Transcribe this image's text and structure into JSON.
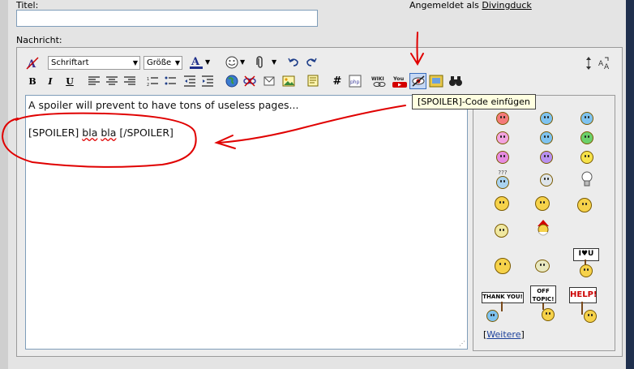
{
  "form": {
    "title_label": "Titel:",
    "logged_in_prefix": "Angemeldet als",
    "username": "Divingduck",
    "message_label": "Nachricht:"
  },
  "toolbar": {
    "font_select": "Schriftart",
    "size_select": "Größe",
    "font_color_glyph": "A",
    "bold": "B",
    "italic": "I",
    "underline": "U",
    "hash": "#",
    "wiki": "WIKI",
    "youtube": "You",
    "binoculars": "♎"
  },
  "editor": {
    "line1": "A spoiler will prevent to have tons of useless pages...",
    "line2_a": "[SPOILER] ",
    "line2_b": "bla",
    "line2_sp": " ",
    "line2_c": "bla",
    "line2_d": " [/SPOILER]"
  },
  "tooltip": "[SPOILER]-Code einfügen",
  "smilies": {
    "more_open": "[",
    "more_label": "Weitere",
    "more_close": "]",
    "sign_love": "I♥U",
    "sign_thanks": "THANK YOU!",
    "sign_offtopic": "OFF TOPIC!",
    "sign_help": "HELP!",
    "confused": "???"
  },
  "annotations": {
    "color": "#e00000"
  }
}
